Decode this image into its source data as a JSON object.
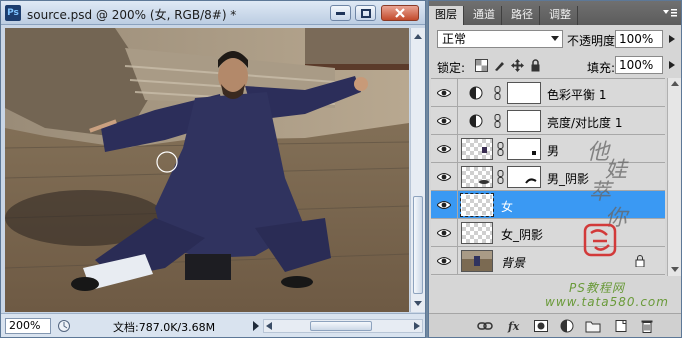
{
  "document_window": {
    "app_badge": "Ps",
    "title": "source.psd @ 200% (女, RGB/8#) *",
    "buttons": {
      "minimize": "minimize",
      "restore": "restore",
      "close": "close"
    },
    "status": {
      "zoom": "200%",
      "doc_info": "文档:787.0K/3.68M"
    }
  },
  "layers_panel": {
    "tabs": [
      "图层",
      "通道",
      "路径",
      "调整"
    ],
    "active_tab": 0,
    "blend_mode": "正常",
    "opacity_label": "不透明度:",
    "opacity_value": "100%",
    "lock_label": "锁定:",
    "fill_label": "填充:",
    "fill_value": "100%",
    "layers": [
      {
        "name": "色彩平衡 1",
        "kind": "adjustment-color-balance",
        "visible": true
      },
      {
        "name": "亮度/对比度 1",
        "kind": "adjustment-brightness-contrast",
        "visible": true
      },
      {
        "name": "男",
        "kind": "pixel-with-mask",
        "visible": true
      },
      {
        "name": "男_阴影",
        "kind": "pixel-with-mask",
        "visible": true
      },
      {
        "name": "女",
        "kind": "pixel",
        "visible": true,
        "selected": true
      },
      {
        "name": "女_阴影",
        "kind": "pixel",
        "visible": true
      },
      {
        "name": "背景",
        "kind": "background",
        "visible": true,
        "locked": true
      }
    ],
    "watermark_line1": "PS教程网",
    "watermark_line2": "www.tata580.com",
    "handwriting": "他娃萃你",
    "bottom_icons": [
      "link-icon",
      "fx-icon",
      "add-mask-icon",
      "adjustment-layer-icon",
      "new-group-icon",
      "new-layer-icon",
      "trash-icon"
    ]
  },
  "colors": {
    "selection": "#3a99f3",
    "titlebar": "#c9d6e6",
    "panel_tab_bar": "#646464"
  }
}
